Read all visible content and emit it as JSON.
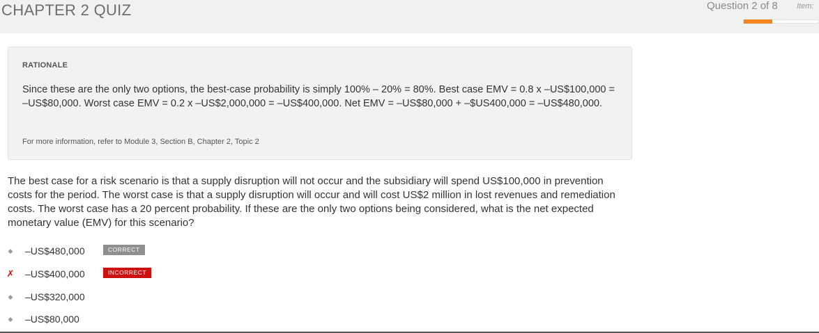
{
  "header": {
    "title": "CHAPTER 2 QUIZ",
    "question_counter": "Question 2 of 8",
    "item_label": "Item:",
    "progress_fraction": 0.375,
    "accent_color": "#f5861f"
  },
  "rationale": {
    "heading": "RATIONALE",
    "text": "Since these are the only two options, the best-case probability is simply 100% – 20% = 80%. Best case EMV = 0.8 x –US$100,000 = –US$80,000. Worst case EMV = 0.2 x –US$2,000,000 = –US$400,000. Net EMV = –US$80,000 + –$US400,000 = –US$480,000.",
    "reference": "For more information, refer to Module 3, Section B, Chapter 2, Topic 2"
  },
  "question": {
    "text": "The best case for a risk scenario is that a supply disruption will not occur and the subsidiary will spend US$100,000 in prevention costs for the period. The worst case is that a supply disruption will occur and will cost US$2 million in lost revenues and remediation costs. The worst case has a 20 percent probability. If these are the only two options being considered, what is the net expected monetary value (EMV) for this scenario?"
  },
  "options": [
    {
      "label": "–US$480,000",
      "marker": "◆",
      "status": "correct",
      "badge": "CORRECT"
    },
    {
      "label": "–US$400,000",
      "marker": "✗",
      "status": "incorrect",
      "badge": "INCORRECT"
    },
    {
      "label": "–US$320,000",
      "marker": "◆",
      "status": "none",
      "badge": ""
    },
    {
      "label": "–US$80,000",
      "marker": "◆",
      "status": "none",
      "badge": ""
    }
  ],
  "colors": {
    "correct_badge": "#8f8f8f",
    "incorrect_badge": "#cc1111"
  }
}
